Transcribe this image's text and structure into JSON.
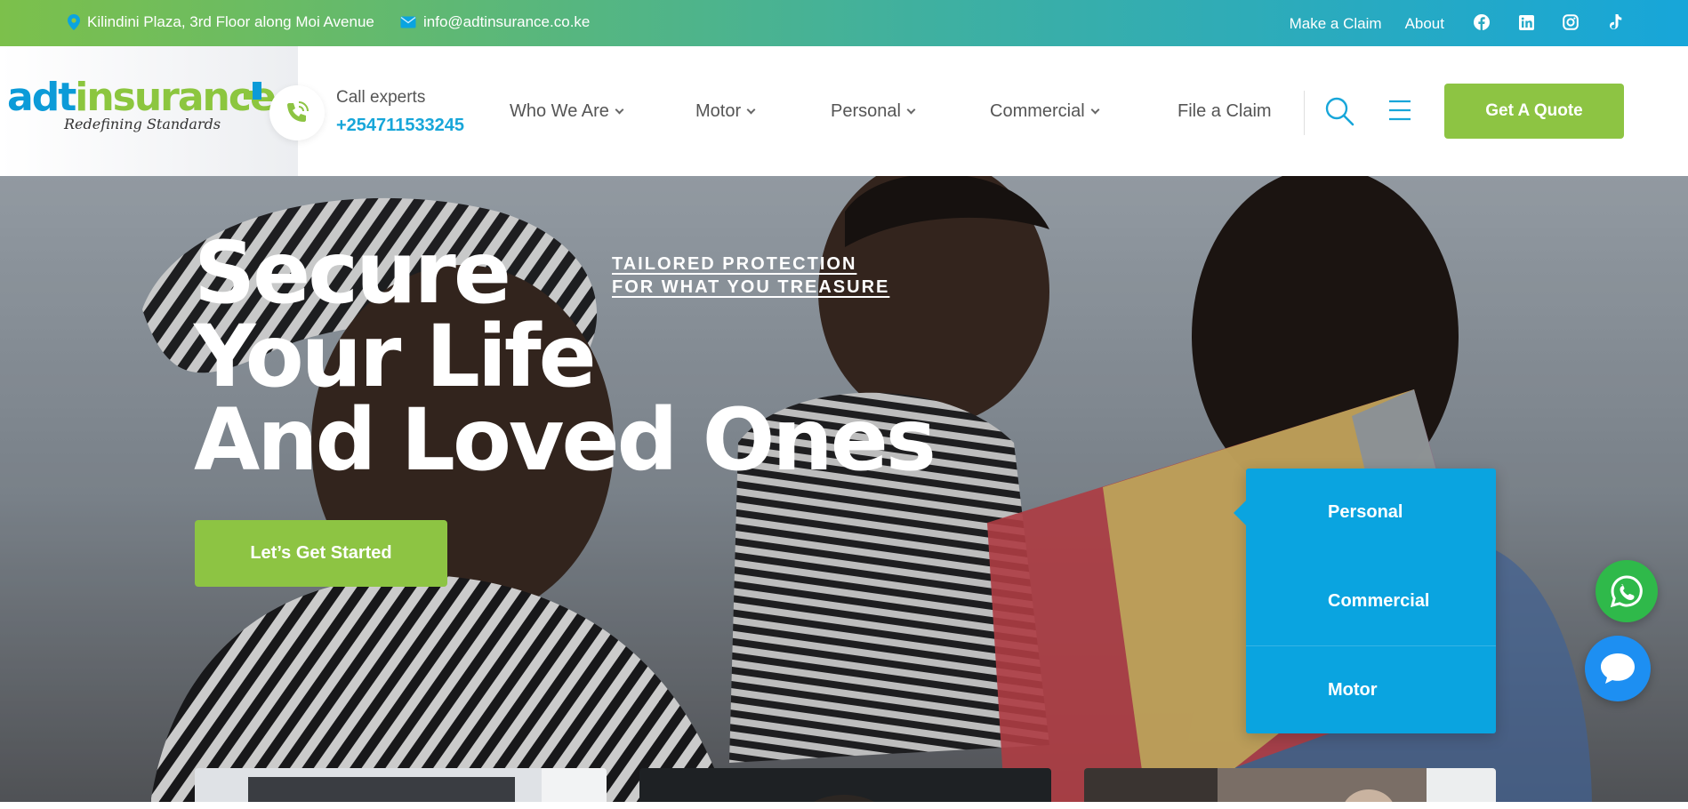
{
  "topbar": {
    "address": "Kilindini Plaza, 3rd Floor along Moi Avenue",
    "email": "info@adtinsurance.co.ke",
    "links": [
      "Make a Claim",
      "About"
    ],
    "socials": [
      "facebook-icon",
      "linkedin-icon",
      "instagram-icon",
      "tiktok-icon"
    ]
  },
  "logo": {
    "part1": "adt",
    "part2": "insurance",
    "tagline": "Redefining Standards"
  },
  "call": {
    "label": "Call experts",
    "number": "+254711533245"
  },
  "nav": {
    "items": [
      {
        "label": "Who We Are",
        "dropdown": true
      },
      {
        "label": "Motor",
        "dropdown": true
      },
      {
        "label": "Personal",
        "dropdown": true
      },
      {
        "label": "Commercial",
        "dropdown": true
      },
      {
        "label": "File a Claim",
        "dropdown": false
      }
    ],
    "cta": "Get A Quote"
  },
  "hero": {
    "title_lines": [
      "Secure",
      "Your Life",
      "And Loved Ones"
    ],
    "tag_lines": [
      "TAILORED PROTECTION",
      "FOR WHAT YOU TREASURE"
    ],
    "button": "Let’s Get Started"
  },
  "dropdown_menu": {
    "items": [
      "Personal",
      "Commercial",
      "Motor"
    ]
  },
  "colors": {
    "green": "#8dc443",
    "blue": "#17a6d9",
    "dropdown": "#0aa4e0",
    "whatsapp": "#2fb94a",
    "chat": "#1d8ff2"
  }
}
